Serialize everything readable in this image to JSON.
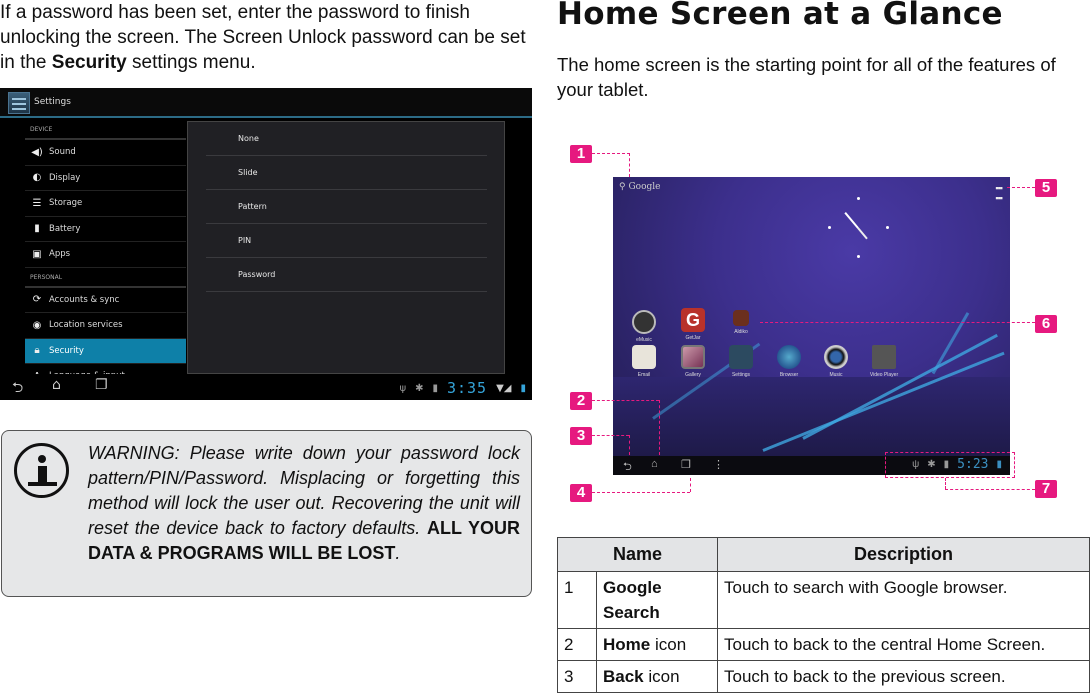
{
  "intro": {
    "text_before": "If a password has been set, enter the password to finish unlocking the screen. The Screen Unlock password can be set in the ",
    "bold": "Security",
    "text_after": " settings menu."
  },
  "settings_screen": {
    "title": "Settings",
    "sections": [
      {
        "label": "DEVICE",
        "items": [
          {
            "label": "Sound",
            "icon": "speaker-icon"
          },
          {
            "label": "Display",
            "icon": "brightness-icon"
          },
          {
            "label": "Storage",
            "icon": "storage-icon"
          },
          {
            "label": "Battery",
            "icon": "battery-icon"
          },
          {
            "label": "Apps",
            "icon": "apps-icon"
          }
        ]
      },
      {
        "label": "PERSONAL",
        "items": [
          {
            "label": "Accounts & sync",
            "icon": "sync-icon"
          },
          {
            "label": "Location services",
            "icon": "location-icon"
          },
          {
            "label": "Security",
            "icon": "lock-icon",
            "active": true
          },
          {
            "label": "Language & input",
            "icon": "keyboard-icon"
          }
        ]
      }
    ],
    "lock_options": [
      "None",
      "Slide",
      "Pattern",
      "PIN",
      "Password"
    ],
    "time": "3:35",
    "accent": "#0e80a8"
  },
  "warning": {
    "italic_text": "WARNING: Please write down your password lock pattern/PIN/Password. Misplacing or forgetting this method will lock the user out. Recovering the unit will reset the device back to factory defaults. ",
    "bold_text": "ALL YOUR DATA & PROGRAMS WILL BE LOST",
    "end": "."
  },
  "home_section": {
    "title": "Home Screen at a Glance",
    "lead": "The home screen is the starting point for all of the features of your tablet."
  },
  "home_screen": {
    "search_label": "Google",
    "time": "5:23",
    "apps_row1": [
      "eMusic",
      "GetJar",
      "Aldiko"
    ],
    "apps_row2": [
      "Email",
      "Gallery",
      "Settings",
      "Browser",
      "Music",
      "Video Player"
    ],
    "callouts": [
      "1",
      "2",
      "3",
      "4",
      "5",
      "6",
      "7"
    ],
    "callout_color": "#e6197f"
  },
  "table": {
    "headers": [
      "Name",
      "Description"
    ],
    "rows": [
      {
        "num": "1",
        "name_bold": "Google Search",
        "name_rest": "",
        "desc": "Touch to search with Google browser."
      },
      {
        "num": "2",
        "name_bold": "Home",
        "name_rest": " icon",
        "desc": "Touch to back to the central Home Screen."
      },
      {
        "num": "3",
        "name_bold": "Back",
        "name_rest": " icon",
        "desc": "Touch to back to the previous screen."
      }
    ]
  }
}
